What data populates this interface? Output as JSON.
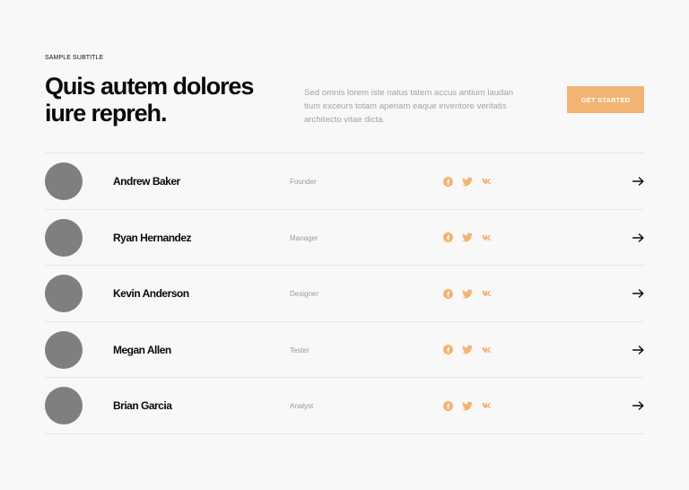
{
  "header": {
    "subtitle": "SAMPLE SUBTITLE",
    "title": "Quis autem dolores iure repreh.",
    "description": "Sed omnis lorem iste natus tatem accus antium laudan tium exceurs totam aperiam eaque inventore veritatis architecto vitae dicta.",
    "cta_label": "GET STARTED"
  },
  "colors": {
    "accent": "#f2b472",
    "avatar": "#7f7f7f",
    "background": "#f8f8f8",
    "divider": "#e7e7e7"
  },
  "icons": {
    "social": [
      "facebook-icon",
      "twitter-icon",
      "vk-icon"
    ],
    "action": "arrow-right-icon"
  },
  "team": [
    {
      "name": "Andrew Baker",
      "role": "Founder"
    },
    {
      "name": "Ryan Hernandez",
      "role": "Manager"
    },
    {
      "name": "Kevin Anderson",
      "role": "Designer"
    },
    {
      "name": "Megan Allen",
      "role": "Tester"
    },
    {
      "name": "Brian Garcia",
      "role": "Analyst"
    }
  ]
}
